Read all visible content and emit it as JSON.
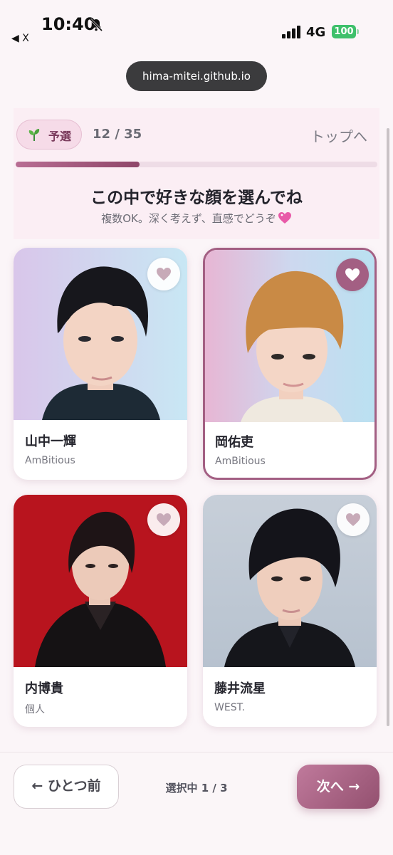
{
  "status_bar": {
    "time": "10:40",
    "back_app": "◀ X",
    "network": "4G",
    "battery": "100"
  },
  "browser": {
    "url": "hima-mitei.github.io"
  },
  "header": {
    "stage_label": "予選",
    "progress_text": "12 / 35",
    "progress_fraction": 0.343,
    "top_link": "トップへ",
    "title": "この中で好きな顔を選んでね",
    "subtitle": "複数OK。深く考えず、直感でどうぞ"
  },
  "cards": [
    {
      "name": "山中一輝",
      "group": "AmBitious",
      "selected": false
    },
    {
      "name": "岡佑吏",
      "group": "AmBitious",
      "selected": true
    },
    {
      "name": "内博貴",
      "group": "個人",
      "selected": false
    },
    {
      "name": "藤井流星",
      "group": "WEST.",
      "selected": false
    }
  ],
  "footer": {
    "prev_label": "← ひとつ前",
    "selection_count": "選択中 1 / 3",
    "next_label": "次へ →"
  },
  "colors": {
    "accent": "#a35f83",
    "badge_bg": "#f6dbe8",
    "battery": "#3ec06b"
  }
}
